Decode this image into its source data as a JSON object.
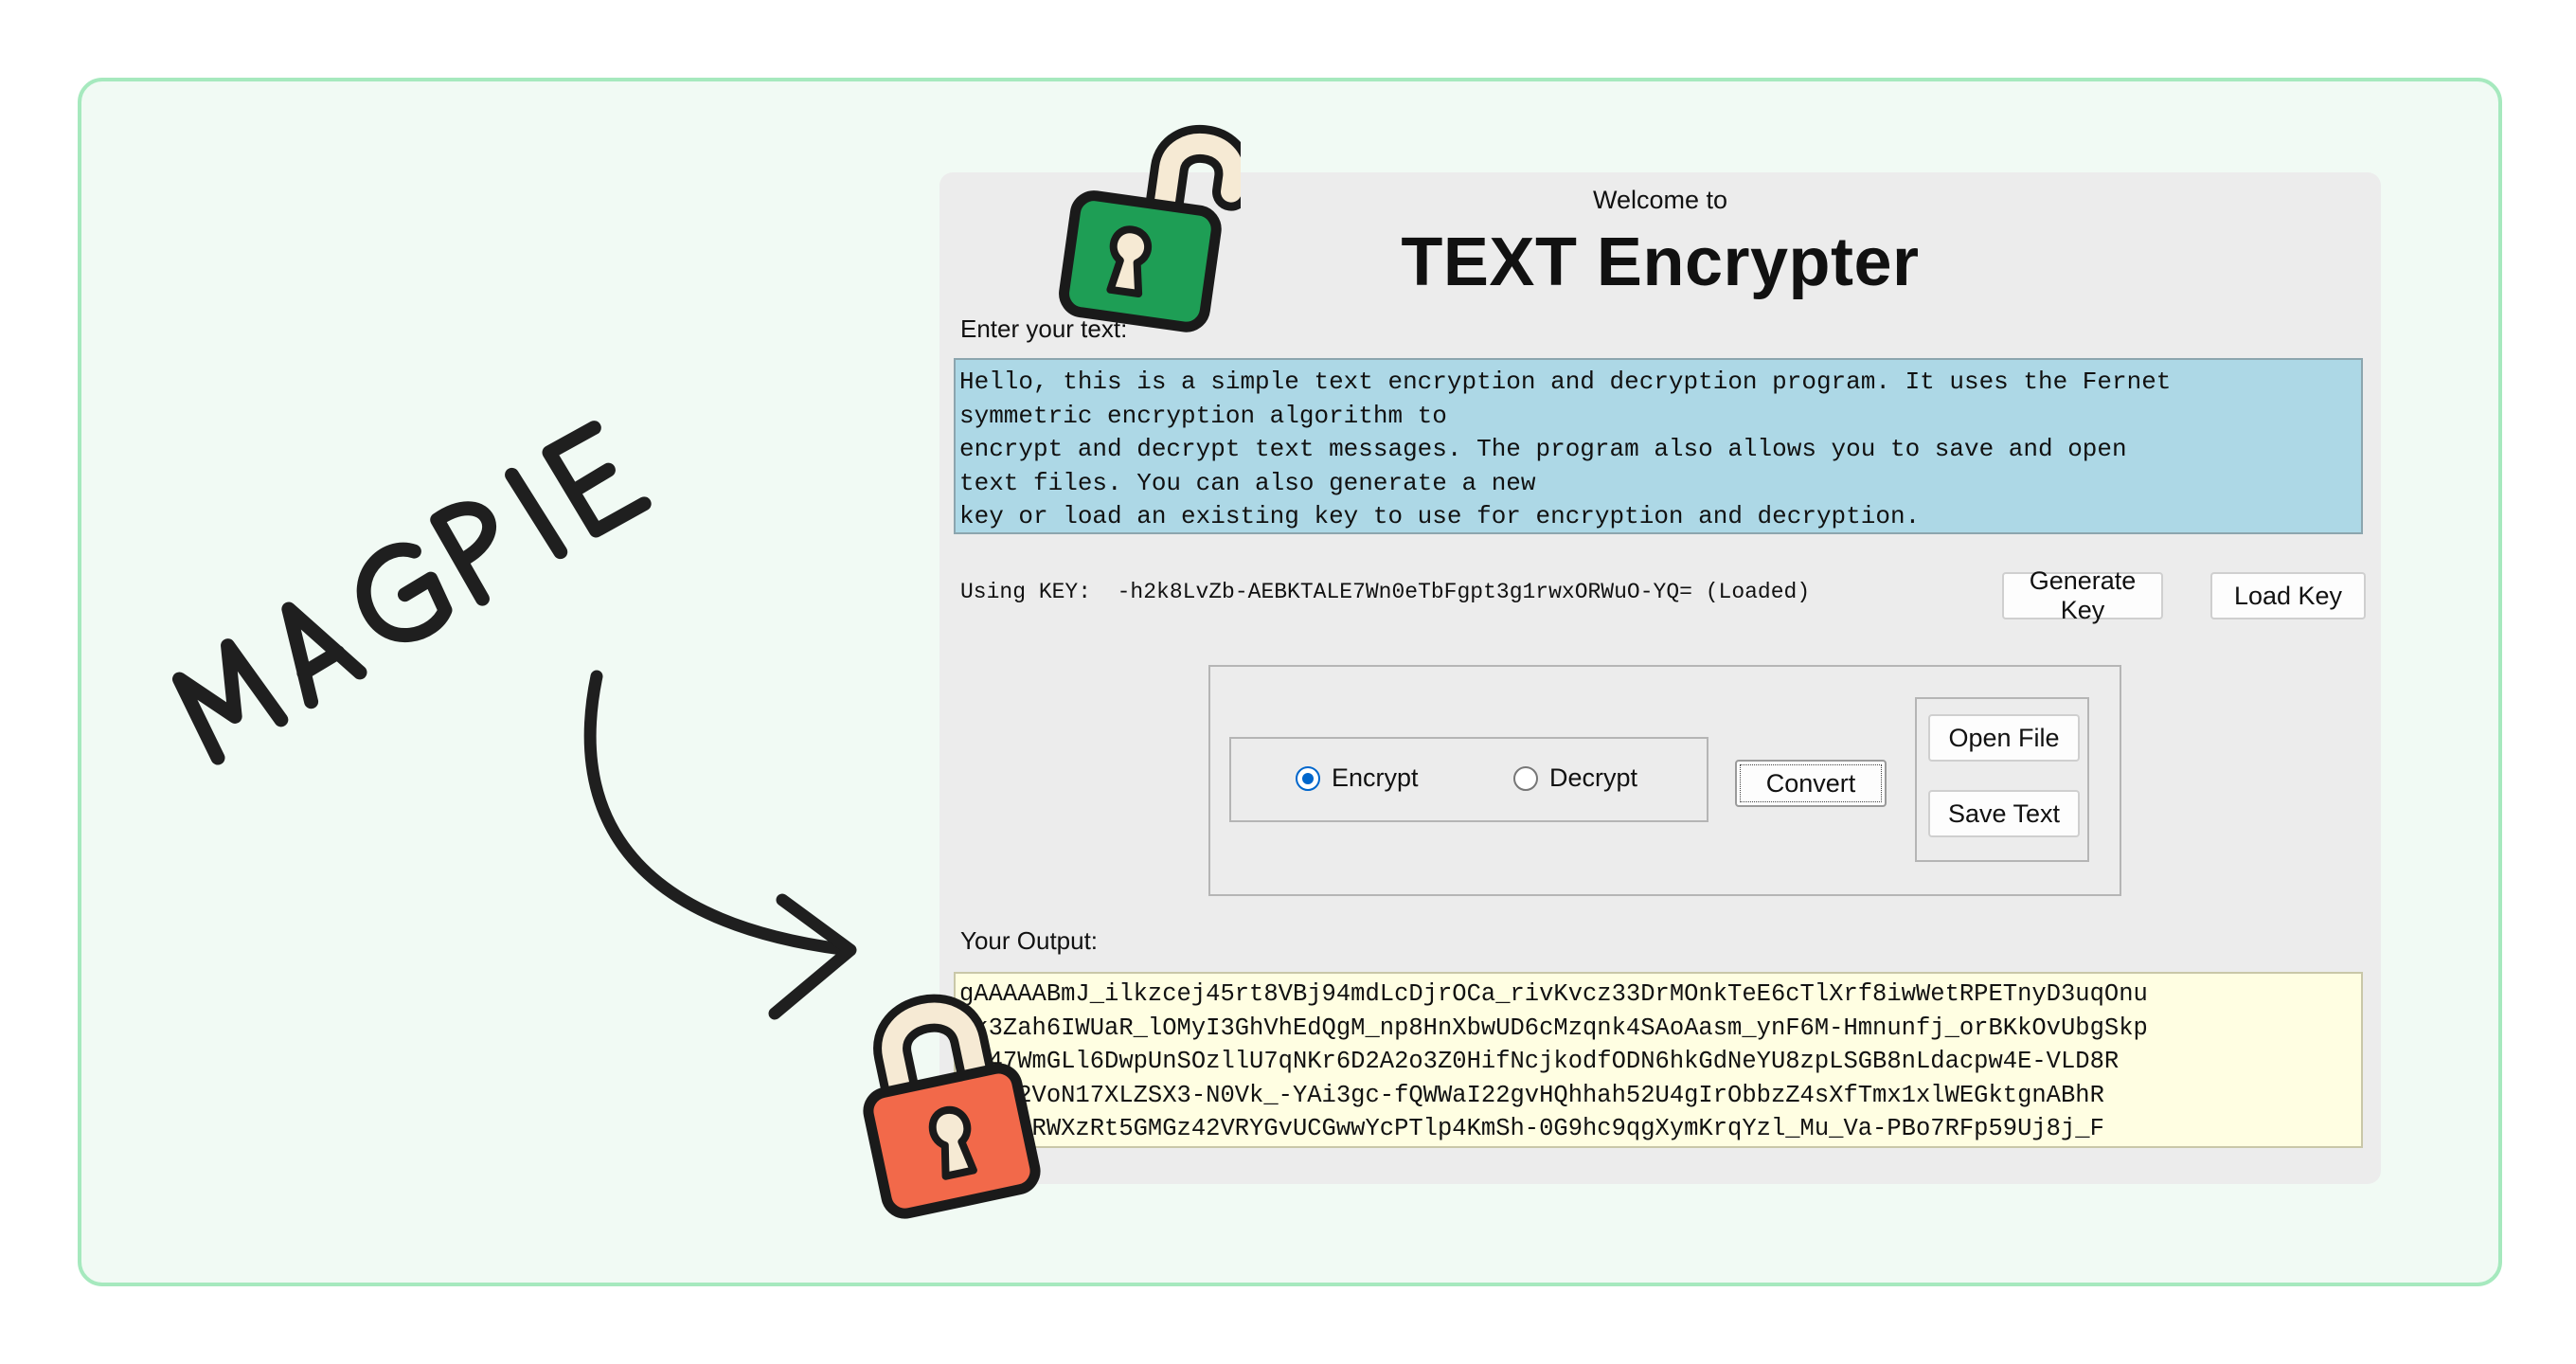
{
  "brand": {
    "text": "MAGPIE"
  },
  "app": {
    "welcome": "Welcome to",
    "title": "TEXT Encrypter",
    "input_label": "Enter your text:",
    "input_lines": [
      "Hello, this is a simple text encryption and decryption program. It uses the Fernet",
      "symmetric encryption algorithm to",
      "encrypt and decrypt text messages. The program also allows you to save and open",
      "text files. You can also generate a new",
      "key or load an existing key to use for encryption and decryption."
    ],
    "key_line": "Using KEY:  -h2k8LvZb-AEBKTALE7Wn0eTbFgpt3g1rwxORWuO-YQ= (Loaded)",
    "generate_key_label": "Generate Key",
    "load_key_label": "Load Key",
    "encrypt_label": "Encrypt",
    "decrypt_label": "Decrypt",
    "selected_mode": "Encrypt",
    "convert_label": "Convert",
    "open_file_label": "Open File",
    "save_text_label": "Save Text",
    "output_label": "Your Output:",
    "output_lines": [
      "gAAAAABmJ_ilkzcej45rt8VBj94mdLcDjrOCa_rivKvcz33DrMOnkTeE6cTlXrf8iwWetRPETnyD3uqOnu",
      "Uk3Zah6IWUaR_lOMyI3GhVhEdQgM_np8HnXbwUD6cMzqnk4SAoAasm_ynF6M-Hmnunfj_orBKkOvUbgSkp",
      "WI47WmGLl6DwpUnSOzllU7qNKr6D2A2o3Z0HifNcjkodfODN6hkGdNeYU8zpLSGB8nLdacpw4E-VLD8R",
      "qUzI2VoN17XLZSX3-N0Vk_-YAi3gc-fQWWaI22gvHQhhah52U4gIrObbzZ4sXfTmx1xlWEGktgnABhR",
      "J3k_pRWXzRt5GMGz42VRYGvUCGwwYcPTlp4KmSh-0G9hc9qgXymKrqYzl_Mu_Va-PBo7RFp59Uj8j_F"
    ]
  },
  "colors": {
    "card_bg": "#f1faf4",
    "card_border": "#a6e9be",
    "input_bg": "#add8e6",
    "output_bg": "#fffee2",
    "lock_open": "#1e9e55",
    "lock_closed": "#f2694a",
    "radio_accent": "#0066cc"
  },
  "icons": [
    "open-padlock-icon",
    "closed-padlock-icon",
    "curved-arrow-icon"
  ]
}
